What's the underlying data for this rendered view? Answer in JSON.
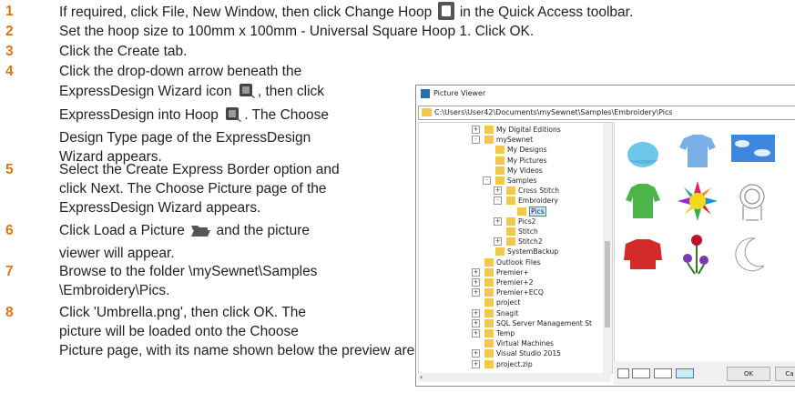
{
  "steps": [
    {
      "num": "1",
      "line1": "If required, click File, New Window, then click Change Hoop",
      "line1b": "in the Quick Access toolbar."
    },
    {
      "num": "2",
      "line1": "Set the hoop size to 100mm x 100mm - Universal Square Hoop 1. Click OK."
    },
    {
      "num": "3",
      "line1": "Click the Create tab."
    },
    {
      "num": "4",
      "line1": "Click the drop-down arrow beneath the",
      "line2a": "ExpressDesign Wizard icon",
      "line2b": ", then click",
      "line3a": "ExpressDesign into Hoop",
      "line3b": ". The Choose",
      "line4": "Design Type page of the ExpressDesign",
      "line5": "Wizard appears."
    },
    {
      "num": "5",
      "line1": "Select the Create Express Border option and",
      "line2": "click Next. The Choose Picture page of the",
      "line3": "ExpressDesign Wizard appears."
    },
    {
      "num": "6",
      "line1a": "Click Load a Picture",
      "line1b": "and the picture",
      "line2": "viewer will appear."
    },
    {
      "num": "7",
      "line1": "Browse to the folder \\mySewnet\\Samples",
      "line2": "\\Embroidery\\Pics."
    },
    {
      "num": "8",
      "line1": "Click 'Umbrella.png', then click OK. The",
      "line2": "picture will be loaded onto the Choose",
      "line3": "Picture page, with its name shown below the preview area."
    }
  ],
  "viewer": {
    "title": "Picture Viewer",
    "path": "C:\\Users\\User42\\Documents\\mySewnet\\Samples\\Embroidery\\Pics",
    "tree": [
      {
        "label": "My Digital Editions",
        "exp": "+"
      },
      {
        "label": "mySewnet",
        "exp": "-"
      },
      {
        "label": "My Designs"
      },
      {
        "label": "My Pictures"
      },
      {
        "label": "My Videos"
      },
      {
        "label": "Samples",
        "exp": "-"
      },
      {
        "label": "Cross Stitch",
        "exp": "+"
      },
      {
        "label": "Embroidery",
        "exp": "-"
      },
      {
        "label": "Pics"
      },
      {
        "label": "Pics2",
        "exp": "+"
      },
      {
        "label": "Stitch"
      },
      {
        "label": "Stitch2",
        "exp": "+"
      },
      {
        "label": "SystemBackup"
      },
      {
        "label": "Outlook Files"
      },
      {
        "label": "Premier+",
        "exp": "+"
      },
      {
        "label": "Premier+2",
        "exp": "+"
      },
      {
        "label": "Premier+ECQ",
        "exp": "+"
      },
      {
        "label": "project"
      },
      {
        "label": "Snagit",
        "exp": "+"
      },
      {
        "label": "SQL Server Management St",
        "exp": "+"
      },
      {
        "label": "Temp",
        "exp": "+"
      },
      {
        "label": "Virtual Machines"
      },
      {
        "label": "Visual Studio 2015",
        "exp": "+"
      },
      {
        "label": "project.zip",
        "exp": "+"
      }
    ],
    "ok": "OK",
    "cancel": "Ca"
  },
  "colors": {
    "accent": "#e07414",
    "selection": "#cde8ff"
  }
}
